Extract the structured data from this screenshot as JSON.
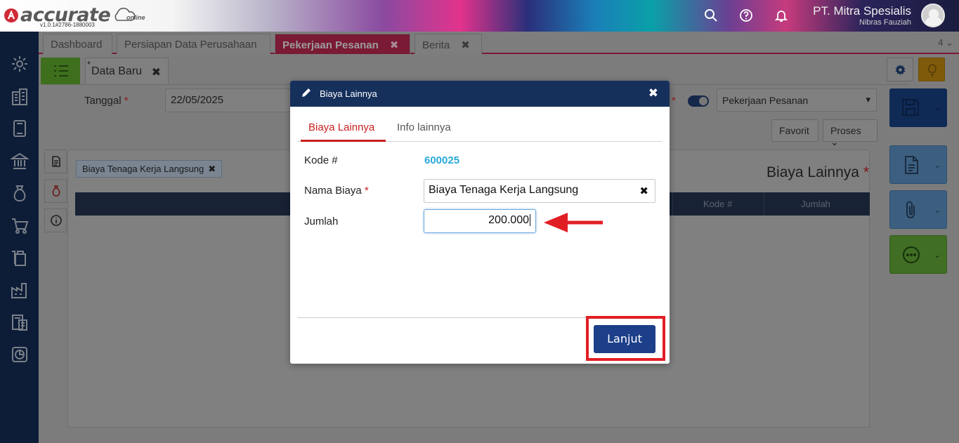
{
  "app": {
    "logo_text": "accurate",
    "logo_sub": "online",
    "version": "v1.0.1#2786-1880003",
    "company_name": "PT. Mitra Spesialis",
    "user_name": "Nibras Fauziah"
  },
  "top_icons": [
    "search-icon",
    "help-icon",
    "bell-icon"
  ],
  "sidebar_icons": [
    "settings-icon",
    "building-icon",
    "book-icon",
    "bank-icon",
    "money-bag-icon",
    "cart-icon",
    "box-icon",
    "factory-icon",
    "tax-report-icon",
    "chart-icon"
  ],
  "tabs": [
    {
      "label": "Dashboard"
    },
    {
      "label": "Persiapan Data Perusahaan"
    },
    {
      "label": "Pekerjaan Pesanan",
      "close": "✖"
    },
    {
      "label": "Berita",
      "close": "✖"
    }
  ],
  "tab_count": "4",
  "form": {
    "subtab_star": "*",
    "subtab_label": "Data Baru",
    "subtab_close": "✖",
    "tanggal_label": "Tanggal",
    "required_mark": "*",
    "tanggal_value": "22/05/2025",
    "type_select": "Pekerjaan Pesanan",
    "favorit_label": "Favorit",
    "proses_label": "Proses",
    "chip_label": "Biaya Tenaga Kerja Langsung",
    "chip_close": "✖",
    "panel_title": "Biaya Lainnya",
    "columns": [
      "Kode #",
      "Jumlah"
    ]
  },
  "modal": {
    "title": "Biaya Lainnya",
    "close": "✖",
    "tabs": [
      "Biaya Lainnya",
      "Info lainnya"
    ],
    "kode_label": "Kode #",
    "kode_value": "600025",
    "nama_label": "Nama Biaya",
    "nama_value": "Biaya Tenaga Kerja Langsung",
    "clear": "✖",
    "jumlah_label": "Jumlah",
    "jumlah_value": "200.000",
    "lanjut_label": "Lanjut"
  },
  "colors": {
    "modal_header": "#16305c",
    "accent_red": "#c8201e",
    "kode_blue": "#2aa8d6",
    "lanjut_button": "#1d3f8a",
    "annotation_red": "#e21e25"
  }
}
